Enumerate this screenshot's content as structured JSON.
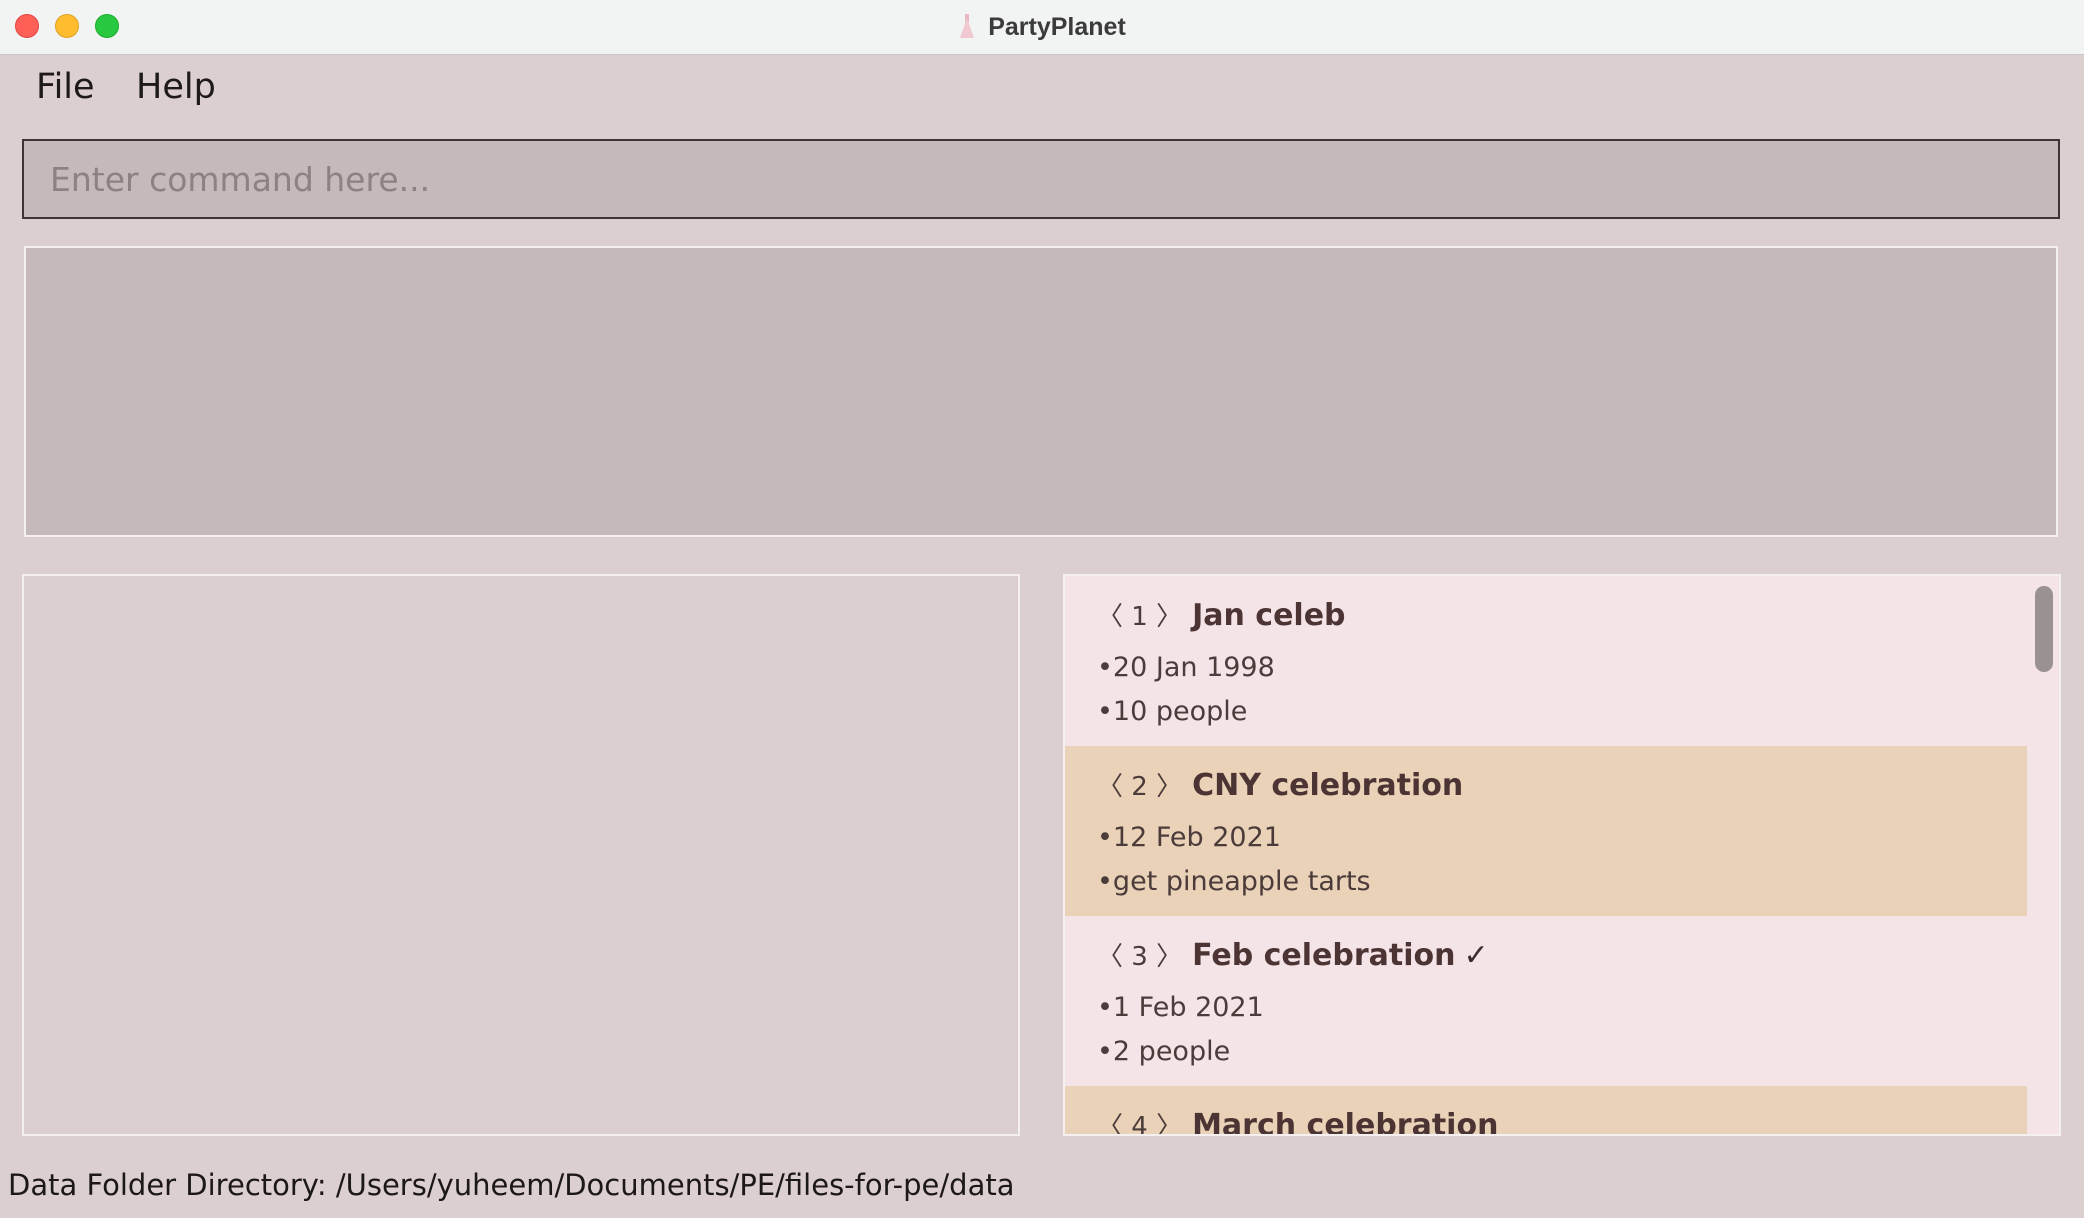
{
  "window": {
    "title": "PartyPlanet"
  },
  "menu": {
    "file": "File",
    "help": "Help"
  },
  "command": {
    "placeholder": "Enter command here...",
    "value": ""
  },
  "result": {
    "text": ""
  },
  "events": [
    {
      "index": "〈 1 〉",
      "name": "Jan celeb",
      "done": "",
      "line1": "•20 Jan 1998",
      "line2": "•10 people"
    },
    {
      "index": "〈 2 〉",
      "name": "CNY celebration",
      "done": "",
      "line1": "•12 Feb 2021",
      "line2": "•get pineapple tarts"
    },
    {
      "index": "〈 3 〉",
      "name": "Feb celebration",
      "done": "✓",
      "line1": "•1 Feb 2021",
      "line2": "•2 people"
    },
    {
      "index": "〈 4 〉",
      "name": "March celebration",
      "done": "",
      "line1": "",
      "line2": ""
    }
  ],
  "status": {
    "data_folder": "Data Folder Directory: /Users/yuheem/Documents/PE/files-for-pe/data"
  },
  "colors": {
    "card_odd": "#f4e4e7",
    "card_even": "#e9d2b7",
    "background": "#dbcfd0",
    "command_bg": "#c6b9b9"
  }
}
